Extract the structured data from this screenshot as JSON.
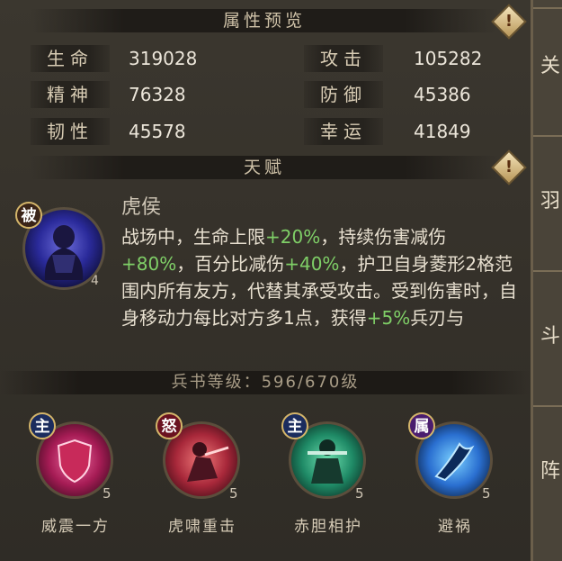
{
  "attributes": {
    "title": "属性预览",
    "warn_symbol": "!",
    "rows": [
      {
        "left_label": "生命",
        "left_value": "319028",
        "right_label": "攻击",
        "right_value": "105282"
      },
      {
        "left_label": "精神",
        "left_value": "76328",
        "right_label": "防御",
        "right_value": "45386"
      },
      {
        "left_label": "韧性",
        "left_value": "45578",
        "right_label": "幸运",
        "right_value": "41849"
      }
    ]
  },
  "talent": {
    "title": "天赋",
    "warn_symbol": "!",
    "tag": "被",
    "level": "4",
    "name": "虎侯",
    "description": {
      "p1": "战场中，生命上限",
      "v1": "+20%",
      "p2": "，持续伤害减伤",
      "v2": "+80%",
      "p3": "，百分比减伤",
      "v3": "+40%",
      "p4": "，护卫自身菱形2格范围内所有友方，代替其承受攻击。受到伤害时，自身移动力每比对方多1点，获得",
      "v4": "+5%",
      "p5": "兵刃与"
    }
  },
  "book_level": "兵书等级：596/670级",
  "skills": [
    {
      "tag": "主",
      "name": "威震一方",
      "level": "5",
      "tag_color": "#1b2c5e"
    },
    {
      "tag": "怒",
      "name": "虎啸重击",
      "level": "5",
      "tag_color": "#6a1220"
    },
    {
      "tag": "主",
      "name": "赤胆相护",
      "level": "5",
      "tag_color": "#1b2c5e"
    },
    {
      "tag": "属",
      "name": "避祸",
      "level": "5",
      "tag_color": "#4a1c6e"
    }
  ],
  "right_strip_glyphs": [
    "关",
    "羽",
    "斗",
    "阵"
  ]
}
